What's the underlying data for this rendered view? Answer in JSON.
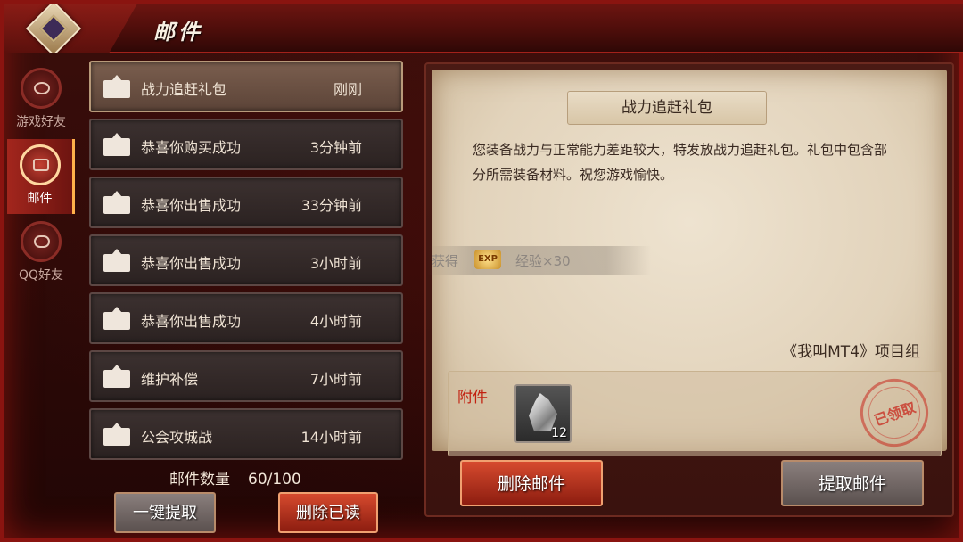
{
  "header": {
    "title": "邮件"
  },
  "side_tabs": [
    {
      "label": "游戏好友",
      "icon": "friends-icon",
      "active": false
    },
    {
      "label": "邮件",
      "icon": "mail-icon",
      "active": true
    },
    {
      "label": "QQ好友",
      "icon": "handshake-icon",
      "active": false
    }
  ],
  "mails": [
    {
      "subject": "战力追赶礼包",
      "time": "刚刚"
    },
    {
      "subject": "恭喜你购买成功",
      "time": "3分钟前"
    },
    {
      "subject": "恭喜你出售成功",
      "time": "33分钟前"
    },
    {
      "subject": "恭喜你出售成功",
      "time": "3小时前"
    },
    {
      "subject": "恭喜你出售成功",
      "time": "4小时前"
    },
    {
      "subject": "维护补偿",
      "time": "7小时前"
    },
    {
      "subject": "公会攻城战",
      "time": "14小时前"
    }
  ],
  "list_footer": {
    "count_label": "邮件数量",
    "count_value": "60/100"
  },
  "buttons": {
    "claim_all": "一键提取",
    "delete_read": "删除已读",
    "delete_mail": "删除邮件",
    "claim_mail": "提取邮件"
  },
  "detail": {
    "title": "战力追赶礼包",
    "body": "您装备战力与正常能力差距较大，特发放战力追赶礼包。礼包中包含部分所需装备材料。祝您游戏愉快。",
    "reward_label": "获得",
    "reward_badge": "EXP",
    "reward_text": "经验×30",
    "signature": "《我叫MT4》项目组",
    "attachment_label": "附件",
    "attachment_count": "12",
    "stamp_text": "已领取"
  },
  "colors": {
    "accent_red": "#c22010",
    "panel_bg": "#e2d3bb",
    "list_item_bg": "#3c3130"
  }
}
